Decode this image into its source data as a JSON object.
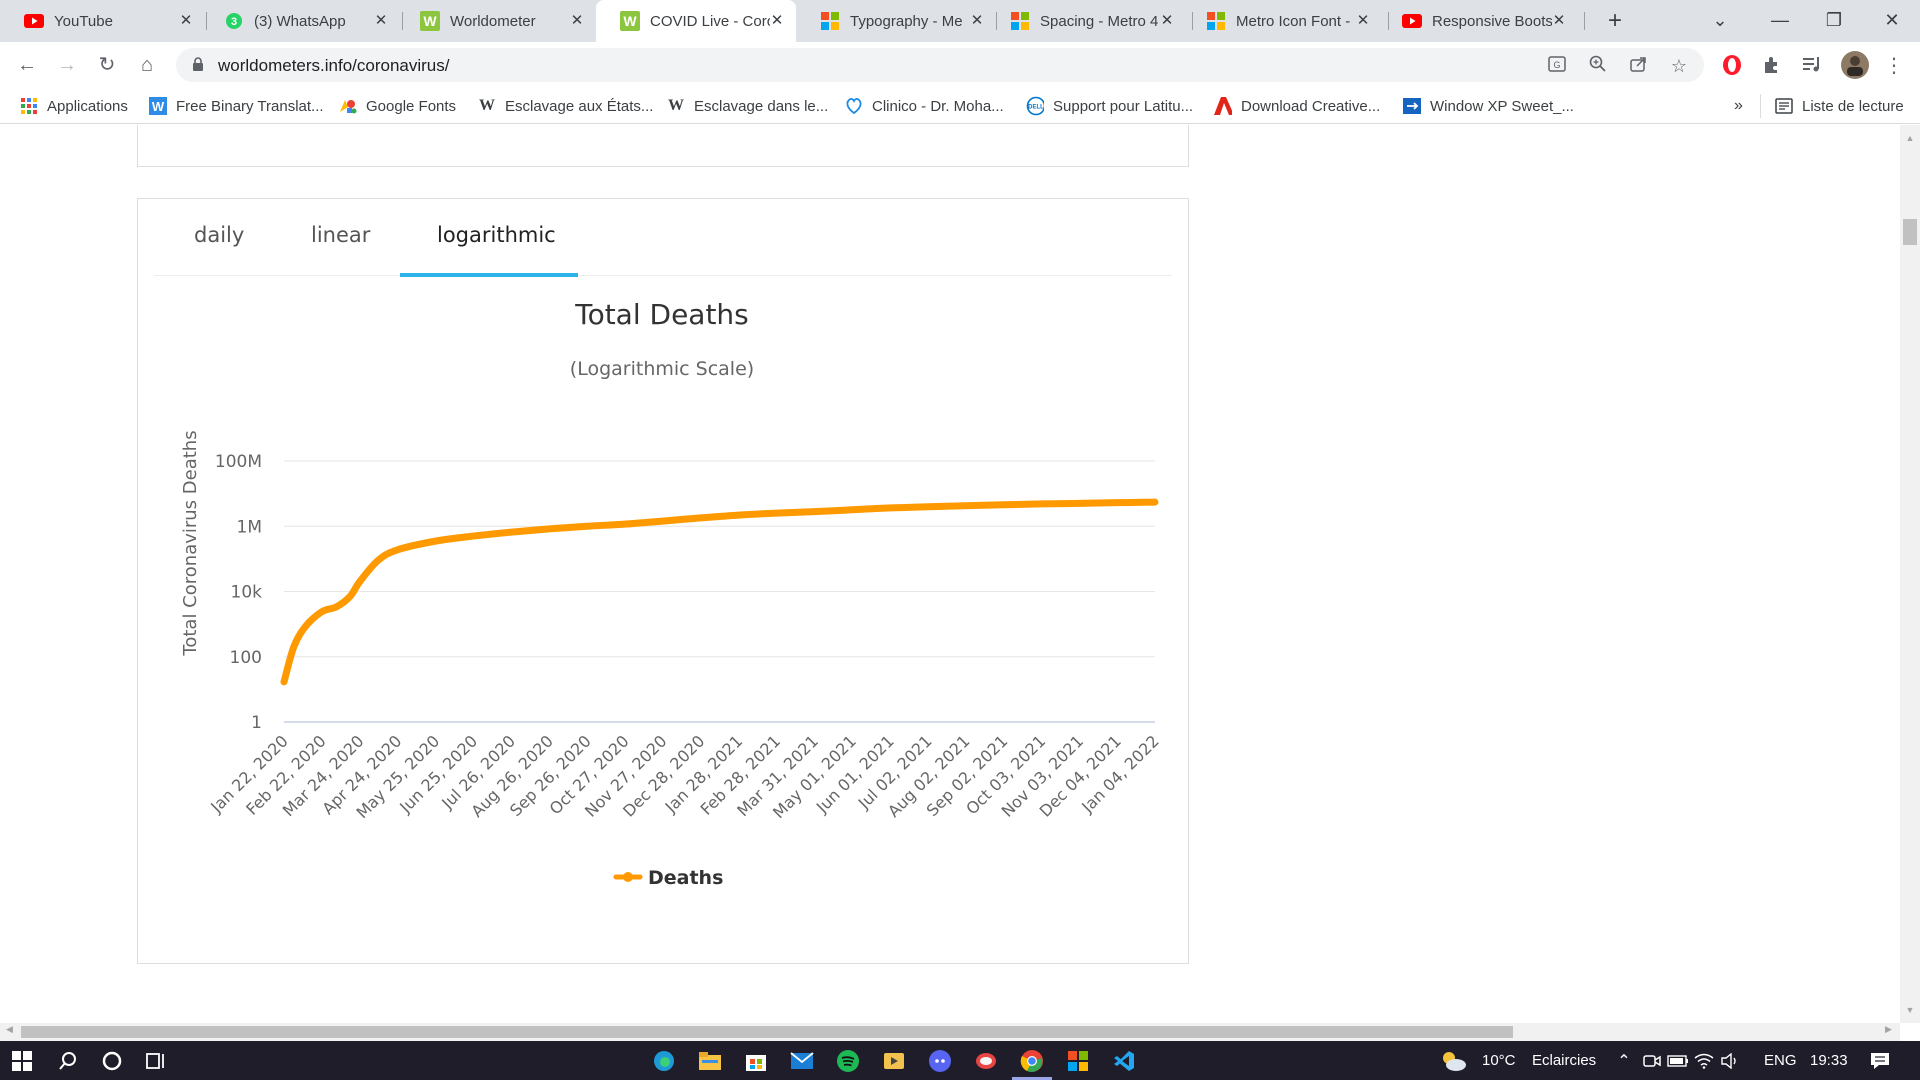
{
  "browser": {
    "tabs": [
      {
        "title": "YouTube",
        "icon": "youtube-icon",
        "color": "#ff0000"
      },
      {
        "title": "(3) WhatsApp",
        "icon": "whatsapp-icon",
        "color": "#25d366"
      },
      {
        "title": "Worldometer",
        "icon": "worldometer-icon",
        "color": "#8cc63f"
      },
      {
        "title": "COVID Live - Coro",
        "icon": "worldometer-icon",
        "color": "#8cc63f",
        "active": true
      },
      {
        "title": "Typography - Me",
        "icon": "metro-icon",
        "color": "#f25022"
      },
      {
        "title": "Spacing - Metro 4",
        "icon": "metro-icon",
        "color": "#f25022"
      },
      {
        "title": "Metro Icon Font -",
        "icon": "metro-icon",
        "color": "#f25022"
      },
      {
        "title": "Responsive Boots",
        "icon": "youtube-icon",
        "color": "#ff0000"
      }
    ],
    "address": {
      "url": "worldometers.info/coronavirus/"
    },
    "bookmarks": [
      {
        "label": "Applications",
        "icon": "apps-grid-icon"
      },
      {
        "label": "Free Binary Translat...",
        "icon": "w-icon"
      },
      {
        "label": "Google Fonts",
        "icon": "google-fonts-icon"
      },
      {
        "label": "Esclavage aux États...",
        "icon": "wikipedia-icon"
      },
      {
        "label": "Esclavage dans le...",
        "icon": "wikipedia-icon"
      },
      {
        "label": "Clinico - Dr. Moha...",
        "icon": "clinico-icon"
      },
      {
        "label": "Support pour Latitu...",
        "icon": "dell-icon"
      },
      {
        "label": "Download Creative...",
        "icon": "adobe-icon"
      },
      {
        "label": "Window XP Sweet_...",
        "icon": "window-icon"
      }
    ],
    "bookmarks_overflow": "»",
    "reading_list": "Liste de lecture"
  },
  "chart_tabs": {
    "daily": "daily",
    "linear": "linear",
    "logarithmic": "logarithmic",
    "active": "logarithmic"
  },
  "chart_data": {
    "type": "line",
    "title": "Total Deaths",
    "subtitle": "(Logarithmic Scale)",
    "ylabel": "Total Coronavirus Deaths",
    "xlabel": "",
    "y_scale": "log",
    "ylim": [
      1,
      100000000
    ],
    "y_ticks": [
      1,
      100,
      10000,
      1000000,
      100000000
    ],
    "y_tick_labels": [
      "1",
      "100",
      "10k",
      "1M",
      "100M"
    ],
    "x_tick_labels": [
      "Jan 22, 2020",
      "Feb 22, 2020",
      "Mar 24, 2020",
      "Apr 24, 2020",
      "May 25, 2020",
      "Jun 25, 2020",
      "Jul 26, 2020",
      "Aug 26, 2020",
      "Sep 26, 2020",
      "Oct 27, 2020",
      "Nov 27, 2020",
      "Dec 28, 2020",
      "Jan 28, 2021",
      "Feb 28, 2021",
      "Mar 31, 2021",
      "May 01, 2021",
      "Jun 01, 2021",
      "Jul 02, 2021",
      "Aug 02, 2021",
      "Sep 02, 2021",
      "Oct 03, 2021",
      "Nov 03, 2021",
      "Dec 04, 2021",
      "Jan 04, 2022"
    ],
    "grid": true,
    "legend_position": "bottom-center",
    "series": [
      {
        "name": "Deaths",
        "color": "#ff9900",
        "x": [
          "Jan 22, 2020",
          "Jan 30, 2020",
          "Feb 8, 2020",
          "Feb 22, 2020",
          "Mar 5, 2020",
          "Mar 16, 2020",
          "Mar 24, 2020",
          "Apr 8, 2020",
          "Apr 24, 2020",
          "May 25, 2020",
          "Jun 25, 2020",
          "Jul 26, 2020",
          "Aug 26, 2020",
          "Sep 26, 2020",
          "Oct 27, 2020",
          "Nov 27, 2020",
          "Dec 28, 2020",
          "Jan 28, 2021",
          "Feb 28, 2021",
          "Mar 31, 2021",
          "May 01, 2021",
          "Jun 01, 2021",
          "Jul 02, 2021",
          "Aug 02, 2021",
          "Sep 02, 2021",
          "Oct 03, 2021",
          "Nov 03, 2021",
          "Dec 04, 2021",
          "Jan 04, 2022"
        ],
        "values": [
          17,
          200,
          800,
          2400,
          3400,
          7000,
          20000,
          90000,
          190000,
          350000,
          500000,
          660000,
          830000,
          1000000,
          1160000,
          1440000,
          1800000,
          2200000,
          2530000,
          2800000,
          3200000,
          3650000,
          3950000,
          4250000,
          4560000,
          4830000,
          5040000,
          5280000,
          5500000
        ]
      }
    ]
  },
  "taskbar": {
    "weather_temp": "10°C",
    "weather_text": "Eclaircies",
    "lang": "ENG",
    "time": "19:33"
  }
}
